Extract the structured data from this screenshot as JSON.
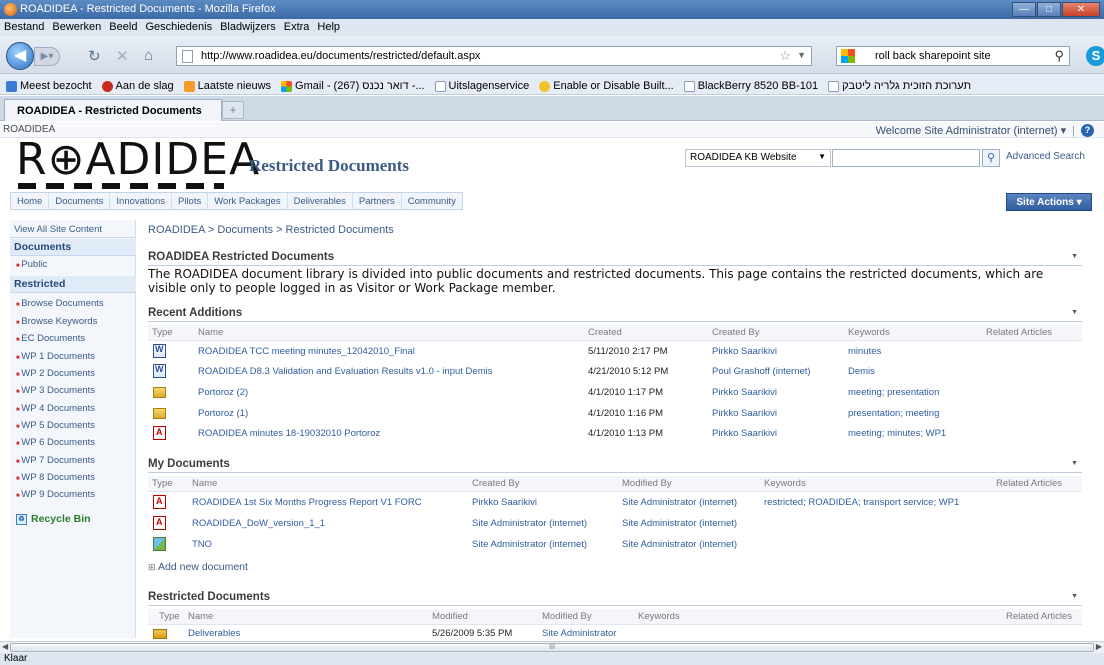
{
  "browser": {
    "window_title": "ROADIDEA - Restricted Documents - Mozilla Firefox",
    "menu": [
      "Bestand",
      "Bewerken",
      "Beeld",
      "Geschiedenis",
      "Bladwijzers",
      "Extra",
      "Help"
    ],
    "url": "http://www.roadidea.eu/documents/restricted/default.aspx",
    "search_value": "roll back sharepoint site",
    "bookmarks": [
      "Meest bezocht",
      "Aan de slag",
      "Laatste nieuws",
      "Gmail - דואר נכנס (267) -...",
      "Uitslagenservice",
      "Enable or Disable Built...",
      "BlackBerry 8520 BB-101",
      "תערוכת הזוכית גלריה ליטבק"
    ],
    "tab_label": "ROADIDEA - Restricted Documents",
    "new_tab": "+",
    "status": "Klaar"
  },
  "sharepoint": {
    "site_label": "ROADIDEA",
    "welcome": "Welcome Site Administrator (internet) ▾",
    "logo_text": "R⊕ADIDEA",
    "site_title": "Restricted Documents",
    "scope": "ROADIDEA KB Website",
    "search_placeholder": "",
    "advanced_search": "Advanced Search",
    "topnav": [
      "Home",
      "Documents",
      "Innovations",
      "Pilots",
      "Work Packages",
      "Deliverables",
      "Partners",
      "Community"
    ],
    "site_actions": "Site Actions ▾",
    "quicklaunch": {
      "view_all": "View All Site Content",
      "documents_head": "Documents",
      "public": "Public",
      "restricted_head": "Restricted",
      "items": [
        "Browse Documents",
        "Browse Keywords",
        "EC Documents",
        "WP 1 Documents",
        "WP 2 Documents",
        "WP 3 Documents",
        "WP 4 Documents",
        "WP 5 Documents",
        "WP 6 Documents",
        "WP 7 Documents",
        "WP 8 Documents",
        "WP 9 Documents"
      ],
      "recycle_bin": "Recycle Bin"
    },
    "breadcrumb": "ROADIDEA > Documents > Restricted Documents",
    "intro_head": "ROADIDEA Restricted Documents",
    "intro_text": "The ROADIDEA document library is divided into public documents and restricted documents. This page contains the restricted documents, which are visible only to people logged in as Visitor or Work Package member.",
    "recent": {
      "title": "Recent Additions",
      "headers": [
        "Type",
        "Name",
        "Created",
        "Created By",
        "Keywords",
        "Related Articles"
      ],
      "rows": [
        {
          "icon": "word",
          "name": "ROADIDEA TCC meeting minutes_12042010_Final",
          "created": "5/11/2010 2:17 PM",
          "by": "Pirkko Saarikivi",
          "keywords": "minutes"
        },
        {
          "icon": "word",
          "name": "ROADIDEA D8.3 Validation and Evaluation Results v1.0 - input Demis",
          "created": "4/21/2010 5:12 PM",
          "by": "Poul Grashoff (internet)",
          "keywords": "Demis"
        },
        {
          "icon": "folder",
          "name": "Portoroz (2)",
          "created": "4/1/2010 1:17 PM",
          "by": "Pirkko Saarikivi",
          "keywords": "meeting; presentation"
        },
        {
          "icon": "folder",
          "name": "Portoroz (1)",
          "created": "4/1/2010 1:16 PM",
          "by": "Pirkko Saarikivi",
          "keywords": "presentation; meeting"
        },
        {
          "icon": "pdf",
          "name": "ROADIDEA minutes 18-19032010 Portoroz",
          "created": "4/1/2010 1:13 PM",
          "by": "Pirkko Saarikivi",
          "keywords": "meeting; minutes; WP1"
        }
      ]
    },
    "mydocs": {
      "title": "My Documents",
      "headers": [
        "Type",
        "Name",
        "Created By",
        "Modified By",
        "Keywords",
        "Related Articles"
      ],
      "rows": [
        {
          "icon": "pdf",
          "name": "ROADIDEA 1st Six Months Progress Report V1 FORC",
          "created_by": "Pirkko Saarikivi",
          "modified_by": "Site Administrator (internet)",
          "keywords": "restricted; ROADIDEA; transport service; WP1"
        },
        {
          "icon": "pdf",
          "name": "ROADIDEA_DoW_version_1_1",
          "created_by": "Site Administrator (internet)",
          "modified_by": "Site Administrator (internet)",
          "keywords": ""
        },
        {
          "icon": "generic",
          "name": "TNO",
          "created_by": "Site Administrator (internet)",
          "modified_by": "Site Administrator (internet)",
          "keywords": ""
        }
      ],
      "add_new": "Add new document"
    },
    "restricted": {
      "title": "Restricted Documents",
      "headers": [
        "Type",
        "Name",
        "Modified",
        "Modified By",
        "Keywords",
        "Related Articles"
      ],
      "rows": [
        {
          "icon": "folder",
          "name": "Deliverables",
          "modified": "5/26/2009 5:35 PM",
          "modified_by": "Site Administrator"
        }
      ]
    }
  }
}
